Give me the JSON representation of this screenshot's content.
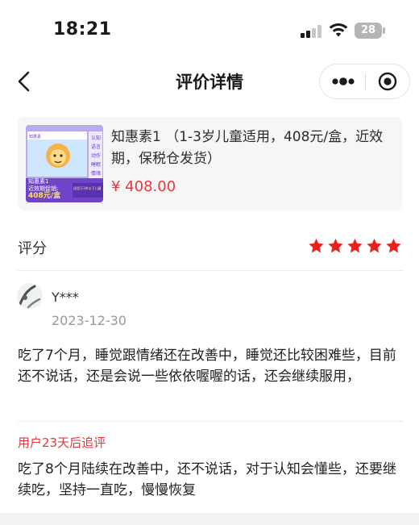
{
  "status_bar": {
    "time": "18:21",
    "battery_level": "28",
    "icons": [
      "signal-icon",
      "wifi-icon",
      "battery-icon"
    ]
  },
  "nav": {
    "title": "评价详情",
    "back_icon": "chevron-left-icon",
    "more_icon": "more-dots-icon",
    "close_icon": "target-close-icon"
  },
  "product": {
    "name": "知惠素1 （1-3岁儿童适用，408元/盒，近效期，保税仓发货）",
    "price": "¥ 408.00",
    "thumbnail": {
      "tags": [
        "认知",
        "语言",
        "动作",
        "睡眠",
        "情绪"
      ],
      "overlay_line1": "知惠素1",
      "overlay_line2": "近效期促销:",
      "overlay_price": "408元/盒",
      "overlay_note": "适用于3岁以下儿童",
      "box_label": "知惠素"
    }
  },
  "rating": {
    "label": "评分",
    "stars": 5,
    "max_stars": 5
  },
  "review": {
    "user_name": "Y***",
    "date": "2023-12-30",
    "text": "吃了7个月，睡觉跟情绪还在改善中，睡觉还比较困难些，目前还不说话，还是会说一些依依喔喔的话，还会继续服用，",
    "followup_label": "用户23天后追评",
    "followup_text": "吃了8个月陆续在改善中，还不说话，对于认知会懂些，还要继续吃，坚持一直吃，慢慢恢复"
  },
  "colors": {
    "accent_red": "#e4393c",
    "star_red": "#e8231e",
    "card_bg": "#f6f6f6"
  }
}
